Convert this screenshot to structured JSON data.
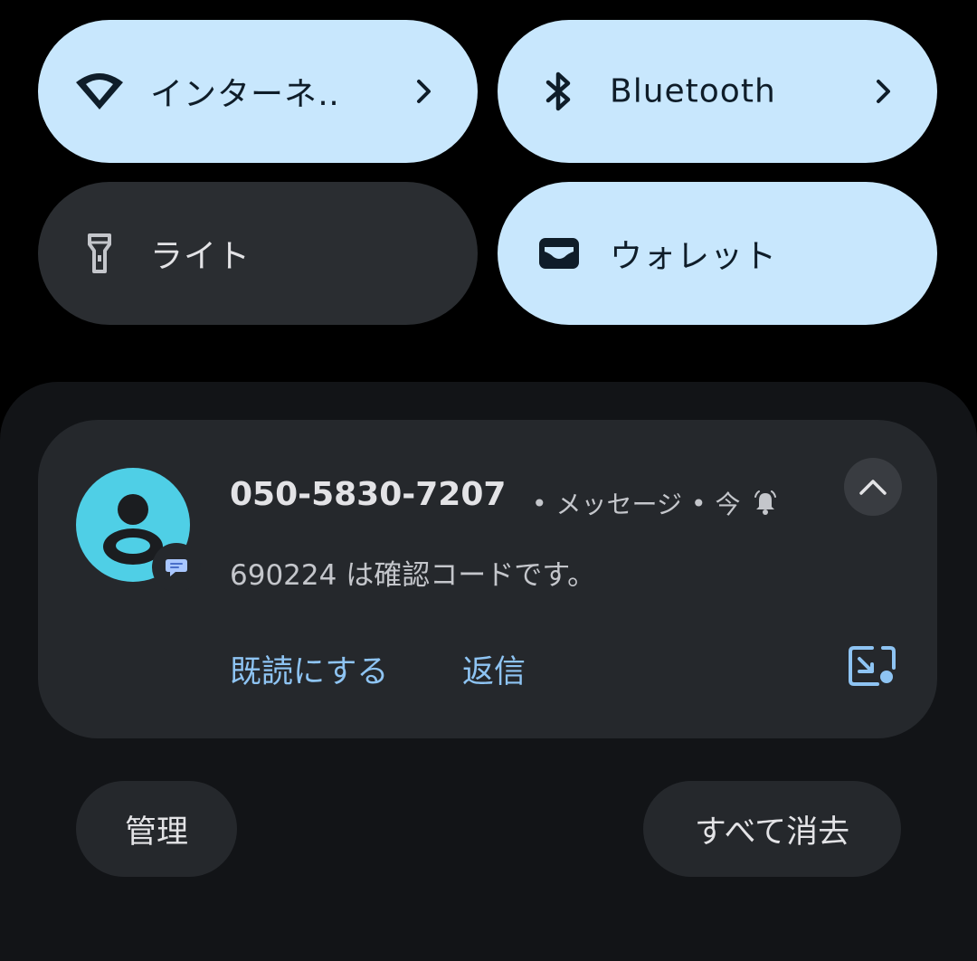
{
  "quick_settings": {
    "internet": {
      "label": "インターネ‥",
      "icon": "wifi-icon",
      "state": "on"
    },
    "bluetooth": {
      "label": "Bluetooth",
      "icon": "bluetooth-icon",
      "state": "on"
    },
    "flashlight": {
      "label": "ライト",
      "icon": "flashlight-icon",
      "state": "off"
    },
    "wallet": {
      "label": "ウォレット",
      "icon": "wallet-icon",
      "state": "on"
    }
  },
  "notification": {
    "sender": "050-5830-7207",
    "app": "メッセージ",
    "time": "今",
    "separator": "•",
    "body": "690224 は確認コードです。",
    "actions": {
      "mark_read": "既読にする",
      "reply": "返信"
    },
    "icons": {
      "avatar": "person-avatar-icon",
      "badge": "messages-app-icon",
      "alert": "bell-icon",
      "collapse": "chevron-up-icon",
      "bubble": "bubble-icon"
    }
  },
  "footer": {
    "manage": "管理",
    "clear_all": "すべて消去"
  },
  "colors": {
    "tile_on_bg": "#c8e7fd",
    "tile_off_bg": "#2a2d31",
    "shade_bg": "#121417",
    "card_bg": "#25282c",
    "accent": "#8ec4f3",
    "avatar_bg": "#4fcfe6"
  }
}
